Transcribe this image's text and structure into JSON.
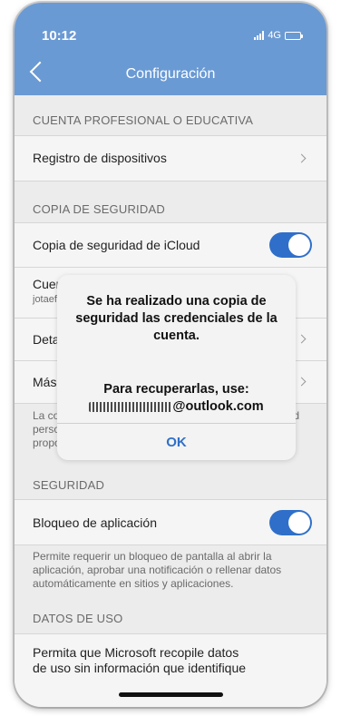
{
  "status_bar": {
    "time": "10:12",
    "network": "4G"
  },
  "nav": {
    "title": "Configuración"
  },
  "sections": {
    "work_account": {
      "header": "CUENTA PROFESIONAL O EDUCATIVA",
      "device_registration": "Registro de dispositivos"
    },
    "backup": {
      "header": "COPIA DE SEGURIDAD",
      "icloud_backup": "Copia de seguridad de iCloud",
      "icloud_backup_on": true,
      "account_partial": "Cuent",
      "account_sub_partial": "jotaef",
      "details_partial": "Detal",
      "more_partial": "Más i",
      "footer_line1": "La co",
      "footer_line1_end": "ud",
      "footer_line2": "perso",
      "footer_line3": "propo"
    },
    "security": {
      "header": "SEGURIDAD",
      "app_lock": "Bloqueo de aplicación",
      "app_lock_on": true,
      "footer": "Permite requerir un bloqueo de pantalla al abrir la aplicación, aprobar una notificación o rellenar datos automáticamente en sitios y aplicaciones."
    },
    "usage": {
      "header": "DATOS DE USO",
      "text_line1": "Permita que Microsoft recopile datos",
      "text_line2": "de uso sin información que identifique"
    }
  },
  "alert": {
    "title": "Se ha realizado una copia de seguridad las credenciales de la cuenta.",
    "body_line1": "Para recuperarlas, use:",
    "email": "@outlook.com",
    "ok": "OK"
  },
  "colors": {
    "accent": "#2f6fc9",
    "header": "#6a9ad4"
  }
}
